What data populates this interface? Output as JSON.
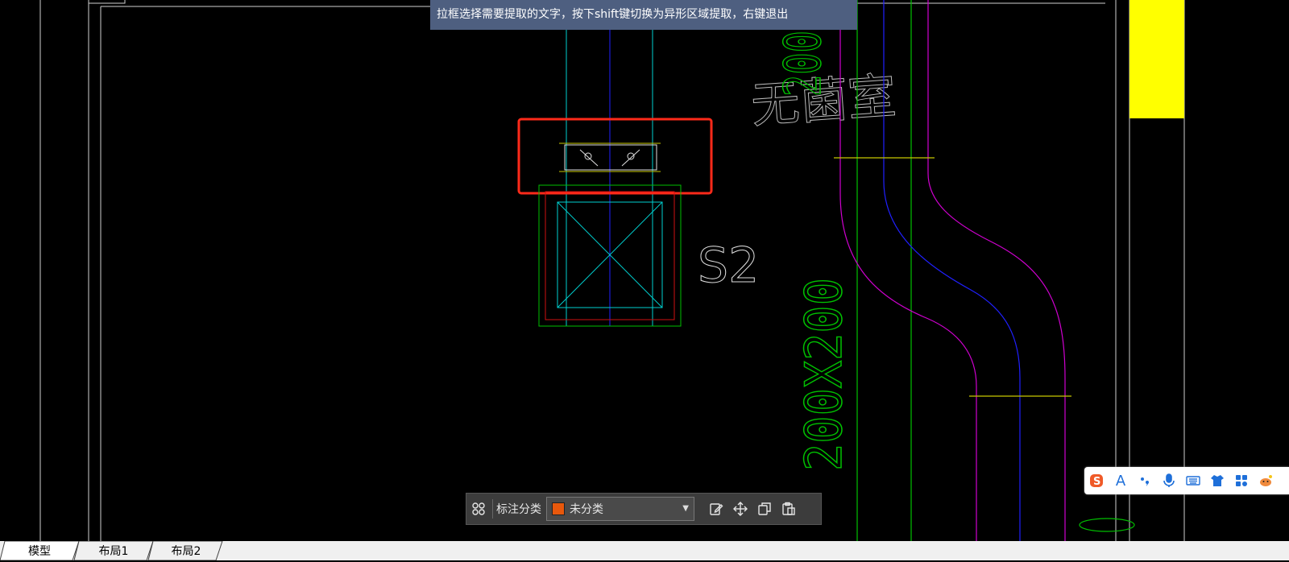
{
  "tooltip": {
    "text": "拉框选择需要提取的文字，按下shift键切换为异形区域提取，右键退出"
  },
  "drawing": {
    "label_s2": "S2",
    "label_room": "无菌室",
    "label_dim": "200X200",
    "label_dim_top": "200"
  },
  "toolbar": {
    "category_label": "标注分类",
    "category_value": "未分类",
    "swatch_color": "#e8580c",
    "icons": [
      "grid-icon",
      "edit-icon",
      "move-icon",
      "copy-icon",
      "paste-icon"
    ]
  },
  "tabs": [
    {
      "label": "模型",
      "active": true
    },
    {
      "label": "布局1",
      "active": false
    },
    {
      "label": "布局2",
      "active": false
    }
  ],
  "ime": {
    "items": [
      "sogou-logo-icon",
      "A",
      "punctuation-icon",
      "microphone-icon",
      "keyboard-icon",
      "skin-icon",
      "apps-icon",
      "mascot-icon"
    ],
    "letter": "A"
  },
  "colors": {
    "highlight_red": "#ff2a1a",
    "cyan": "#00d0d0",
    "green": "#00c000",
    "magenta": "#d000d0",
    "blue": "#2020ff",
    "yellow": "#ffff00"
  }
}
